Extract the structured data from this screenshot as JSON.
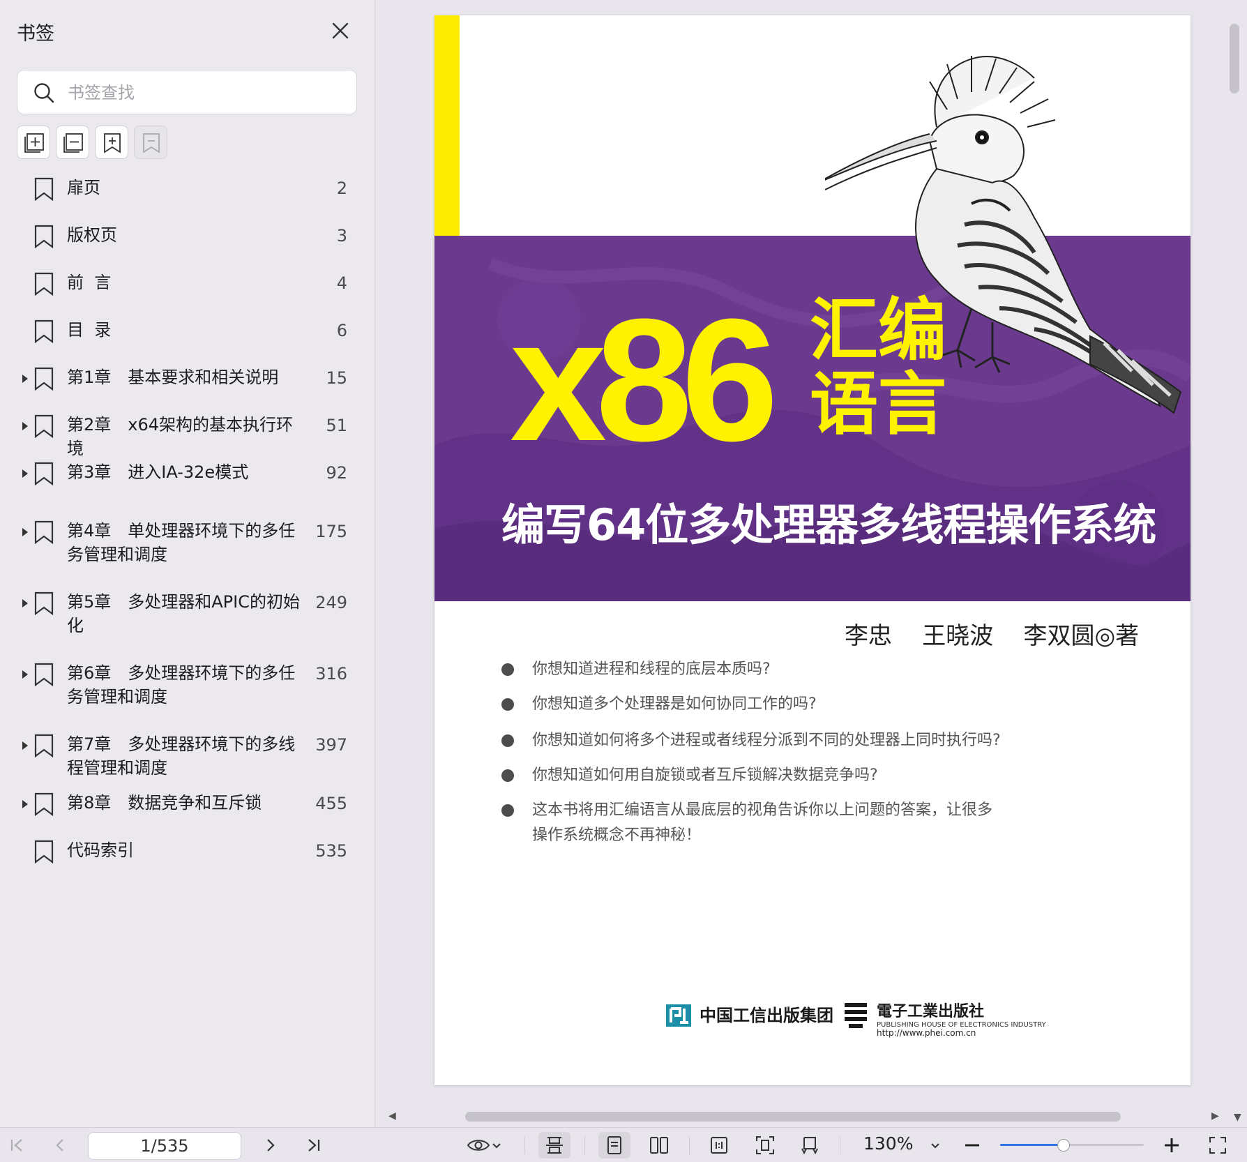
{
  "sidebar": {
    "title": "书签",
    "search_placeholder": "书签查找",
    "tools": [
      "add-bookmark-group-icon",
      "remove-bookmark-group-icon",
      "add-bookmark-icon",
      "remove-bookmark-icon"
    ],
    "items": [
      {
        "label": "扉页",
        "page": "2",
        "expandable": false
      },
      {
        "label": "版权页",
        "page": "3",
        "expandable": false
      },
      {
        "label": "前  言",
        "page": "4",
        "expandable": false
      },
      {
        "label": "目  录",
        "page": "6",
        "expandable": false
      },
      {
        "label": "第1章　基本要求和相关说明",
        "page": "15",
        "expandable": true
      },
      {
        "label": "第2章　x64架构的基本执行环境",
        "page": "51",
        "expandable": true
      },
      {
        "label": "第3章　进入IA-32e模式",
        "page": "92",
        "expandable": true
      },
      {
        "label": "第4章　单处理器环境下的多任务管理和调度",
        "page": "175",
        "expandable": true
      },
      {
        "label": "第5章　多处理器和APIC的初始化",
        "page": "249",
        "expandable": true
      },
      {
        "label": "第6章　多处理器环境下的多任务管理和调度",
        "page": "316",
        "expandable": true
      },
      {
        "label": "第7章　多处理器环境下的多线程管理和调度",
        "page": "397",
        "expandable": true
      },
      {
        "label": "第8章　数据竞争和互斥锁",
        "page": "455",
        "expandable": true
      },
      {
        "label": "代码索引",
        "page": "535",
        "expandable": false
      }
    ]
  },
  "cover": {
    "big_title": "x86",
    "title_line1": "汇编",
    "title_line2": "语言",
    "subtitle": "编写64位多处理器多线程操作系统",
    "authors": "李忠    王晓波    李双圆◎著",
    "questions": [
      "你想知道进程和线程的底层本质吗?",
      "你想知道多个处理器是如何协同工作的吗?",
      "你想知道如何将多个进程或者线程分派到不同的处理器上同时执行吗?",
      "你想知道如何用自旋锁或者互斥锁解决数据竞争吗?",
      "这本书将用汇编语言从最底层的视角告诉你以上问题的答案，让很多\n操作系统概念不再神秘！"
    ],
    "publisher1": "中国工信出版集团",
    "publisher2": "電子工業出版社",
    "publisher2_en": "PUBLISHING HOUSE OF ELECTRONICS INDUSTRY",
    "publisher2_url": "http://www.phei.com.cn",
    "colors": {
      "yellow": "#fff200",
      "purple": "#6b3a8f"
    }
  },
  "toolbar": {
    "page_indicator": "1/535",
    "zoom": "130%",
    "zoom_fraction": 0.44
  }
}
